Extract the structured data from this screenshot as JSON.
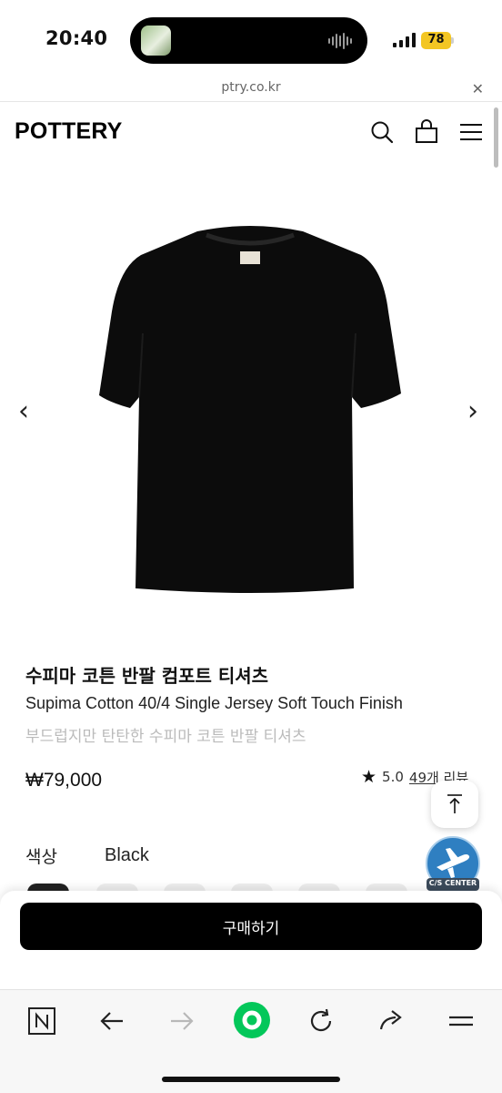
{
  "status_bar": {
    "time": "20:40",
    "battery": "78",
    "icons": [
      "now-playing-thumbnail",
      "audio-waveform-icon",
      "cellular-signal-icon",
      "battery-icon"
    ]
  },
  "browser": {
    "url": "ptry.co.kr",
    "close_icon": "close-icon",
    "toolbar_icons": [
      "naver-n-icon",
      "back-arrow-icon",
      "forward-arrow-icon",
      "naver-green-home-icon",
      "refresh-icon",
      "share-icon",
      "menu-icon"
    ]
  },
  "header": {
    "logo": "POTTERY",
    "icons": [
      "search-icon",
      "shopping-bag-icon",
      "hamburger-menu-icon"
    ]
  },
  "gallery": {
    "prev": "‹",
    "next": "›"
  },
  "product": {
    "title_ko": "수피마 코튼 반팔 컴포트 티셔츠",
    "title_en": "Supima Cotton 40/4 Single Jersey Soft Touch Finish",
    "description": "부드럽지만 탄탄한 수피마 코튼 반팔 티셔츠",
    "price": "₩79,000",
    "rating": "5.0",
    "review_count": "49개 리뷰",
    "color_label": "색상",
    "color_value": "Black"
  },
  "floating": {
    "cs_label": "C/S CENTER"
  },
  "buy": {
    "label": "구매하기"
  },
  "colors": {
    "accent_black": "#000000",
    "battery": "#f3c623",
    "naver_green": "#03c75a"
  }
}
